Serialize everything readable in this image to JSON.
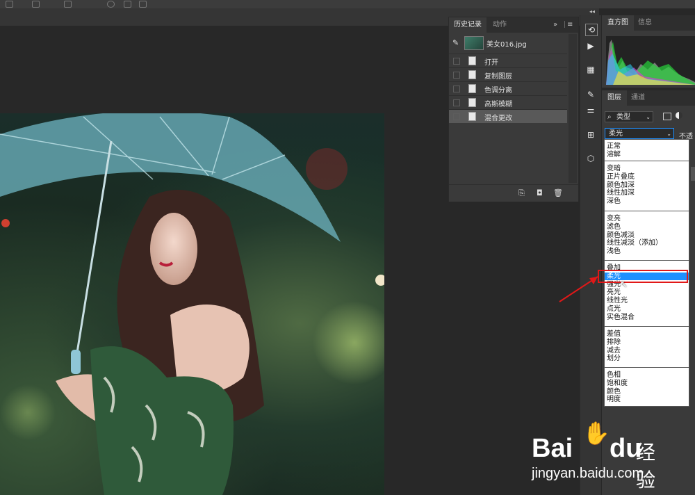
{
  "history_panel": {
    "tabs": [
      "历史记录",
      "动作"
    ],
    "snapshot_label": "美女016.jpg",
    "steps": [
      "打开",
      "复制图层",
      "色调分离",
      "高斯模糊",
      "混合更改"
    ],
    "active_step_index": 4
  },
  "histogram_panel": {
    "tabs": [
      "直方图",
      "信息"
    ]
  },
  "layers_panel": {
    "tabs": [
      "图层",
      "通道"
    ],
    "filter_kind": "类型",
    "blend_mode": "柔光",
    "opacity_label": "不透明"
  },
  "blend_modes": {
    "groups": [
      [
        "正常",
        "溶解"
      ],
      [
        "变暗",
        "正片叠底",
        "颜色加深",
        "线性加深",
        "深色"
      ],
      [
        "变亮",
        "滤色",
        "颜色减淡",
        "线性减淡（添加）",
        "浅色"
      ],
      [
        "叠加",
        "柔光",
        "强光",
        "亮光",
        "线性光",
        "点光",
        "实色混合"
      ],
      [
        "差值",
        "排除",
        "减去",
        "划分"
      ],
      [
        "色相",
        "饱和度",
        "颜色",
        "明度"
      ]
    ],
    "selected": "柔光"
  },
  "watermark": {
    "brand": "Bai",
    "brand2": "du",
    "cn": "经验",
    "url": "jingyan.baidu.com"
  },
  "colors": {
    "accent_selection": "#1e90ff",
    "highlight_box": "#e11818",
    "panel_bg": "#3a3a3a",
    "canvas_bg": "#282828"
  },
  "icons": [
    "brush-icon",
    "camera-icon",
    "trash-icon",
    "new-snapshot-icon",
    "cube-icon",
    "play-icon"
  ]
}
